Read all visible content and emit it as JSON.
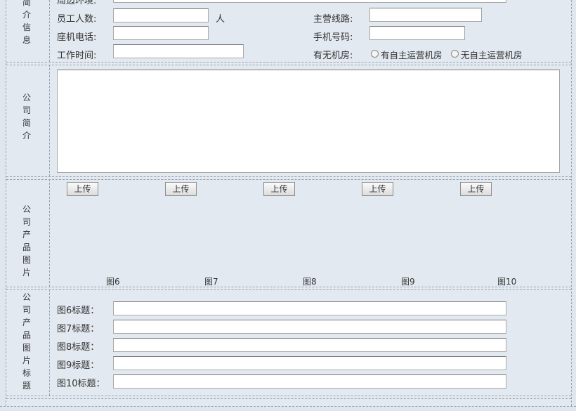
{
  "basic_info": {
    "side_label": [
      "简",
      "介",
      "信",
      "息"
    ],
    "address_label": "周边环境:",
    "employees_label": "员工人数:",
    "employees_unit": "人",
    "main_routes_label": "主营线路:",
    "landline_label": "座机电话:",
    "mobile_label": "手机号码:",
    "work_hours_label": "工作时间:",
    "has_engine_room_label": "有无机房:",
    "option_has_room": "有自主运营机房",
    "option_no_room": "无自主运营机房"
  },
  "intro": {
    "side_label": [
      "公",
      "司",
      "简",
      "介"
    ]
  },
  "product_images": {
    "side_label": [
      "公",
      "司",
      "产",
      "品",
      "图",
      "片"
    ],
    "upload_label": "上传",
    "captions": [
      "图6",
      "图7",
      "图8",
      "图9",
      "图10"
    ]
  },
  "image_titles": {
    "side_label": [
      "公",
      "司",
      "产",
      "品",
      "图",
      "片",
      "标",
      "题"
    ],
    "rows": [
      "图6标题：",
      "图7标题：",
      "图8标题：",
      "图9标题：",
      "图10标题："
    ]
  }
}
